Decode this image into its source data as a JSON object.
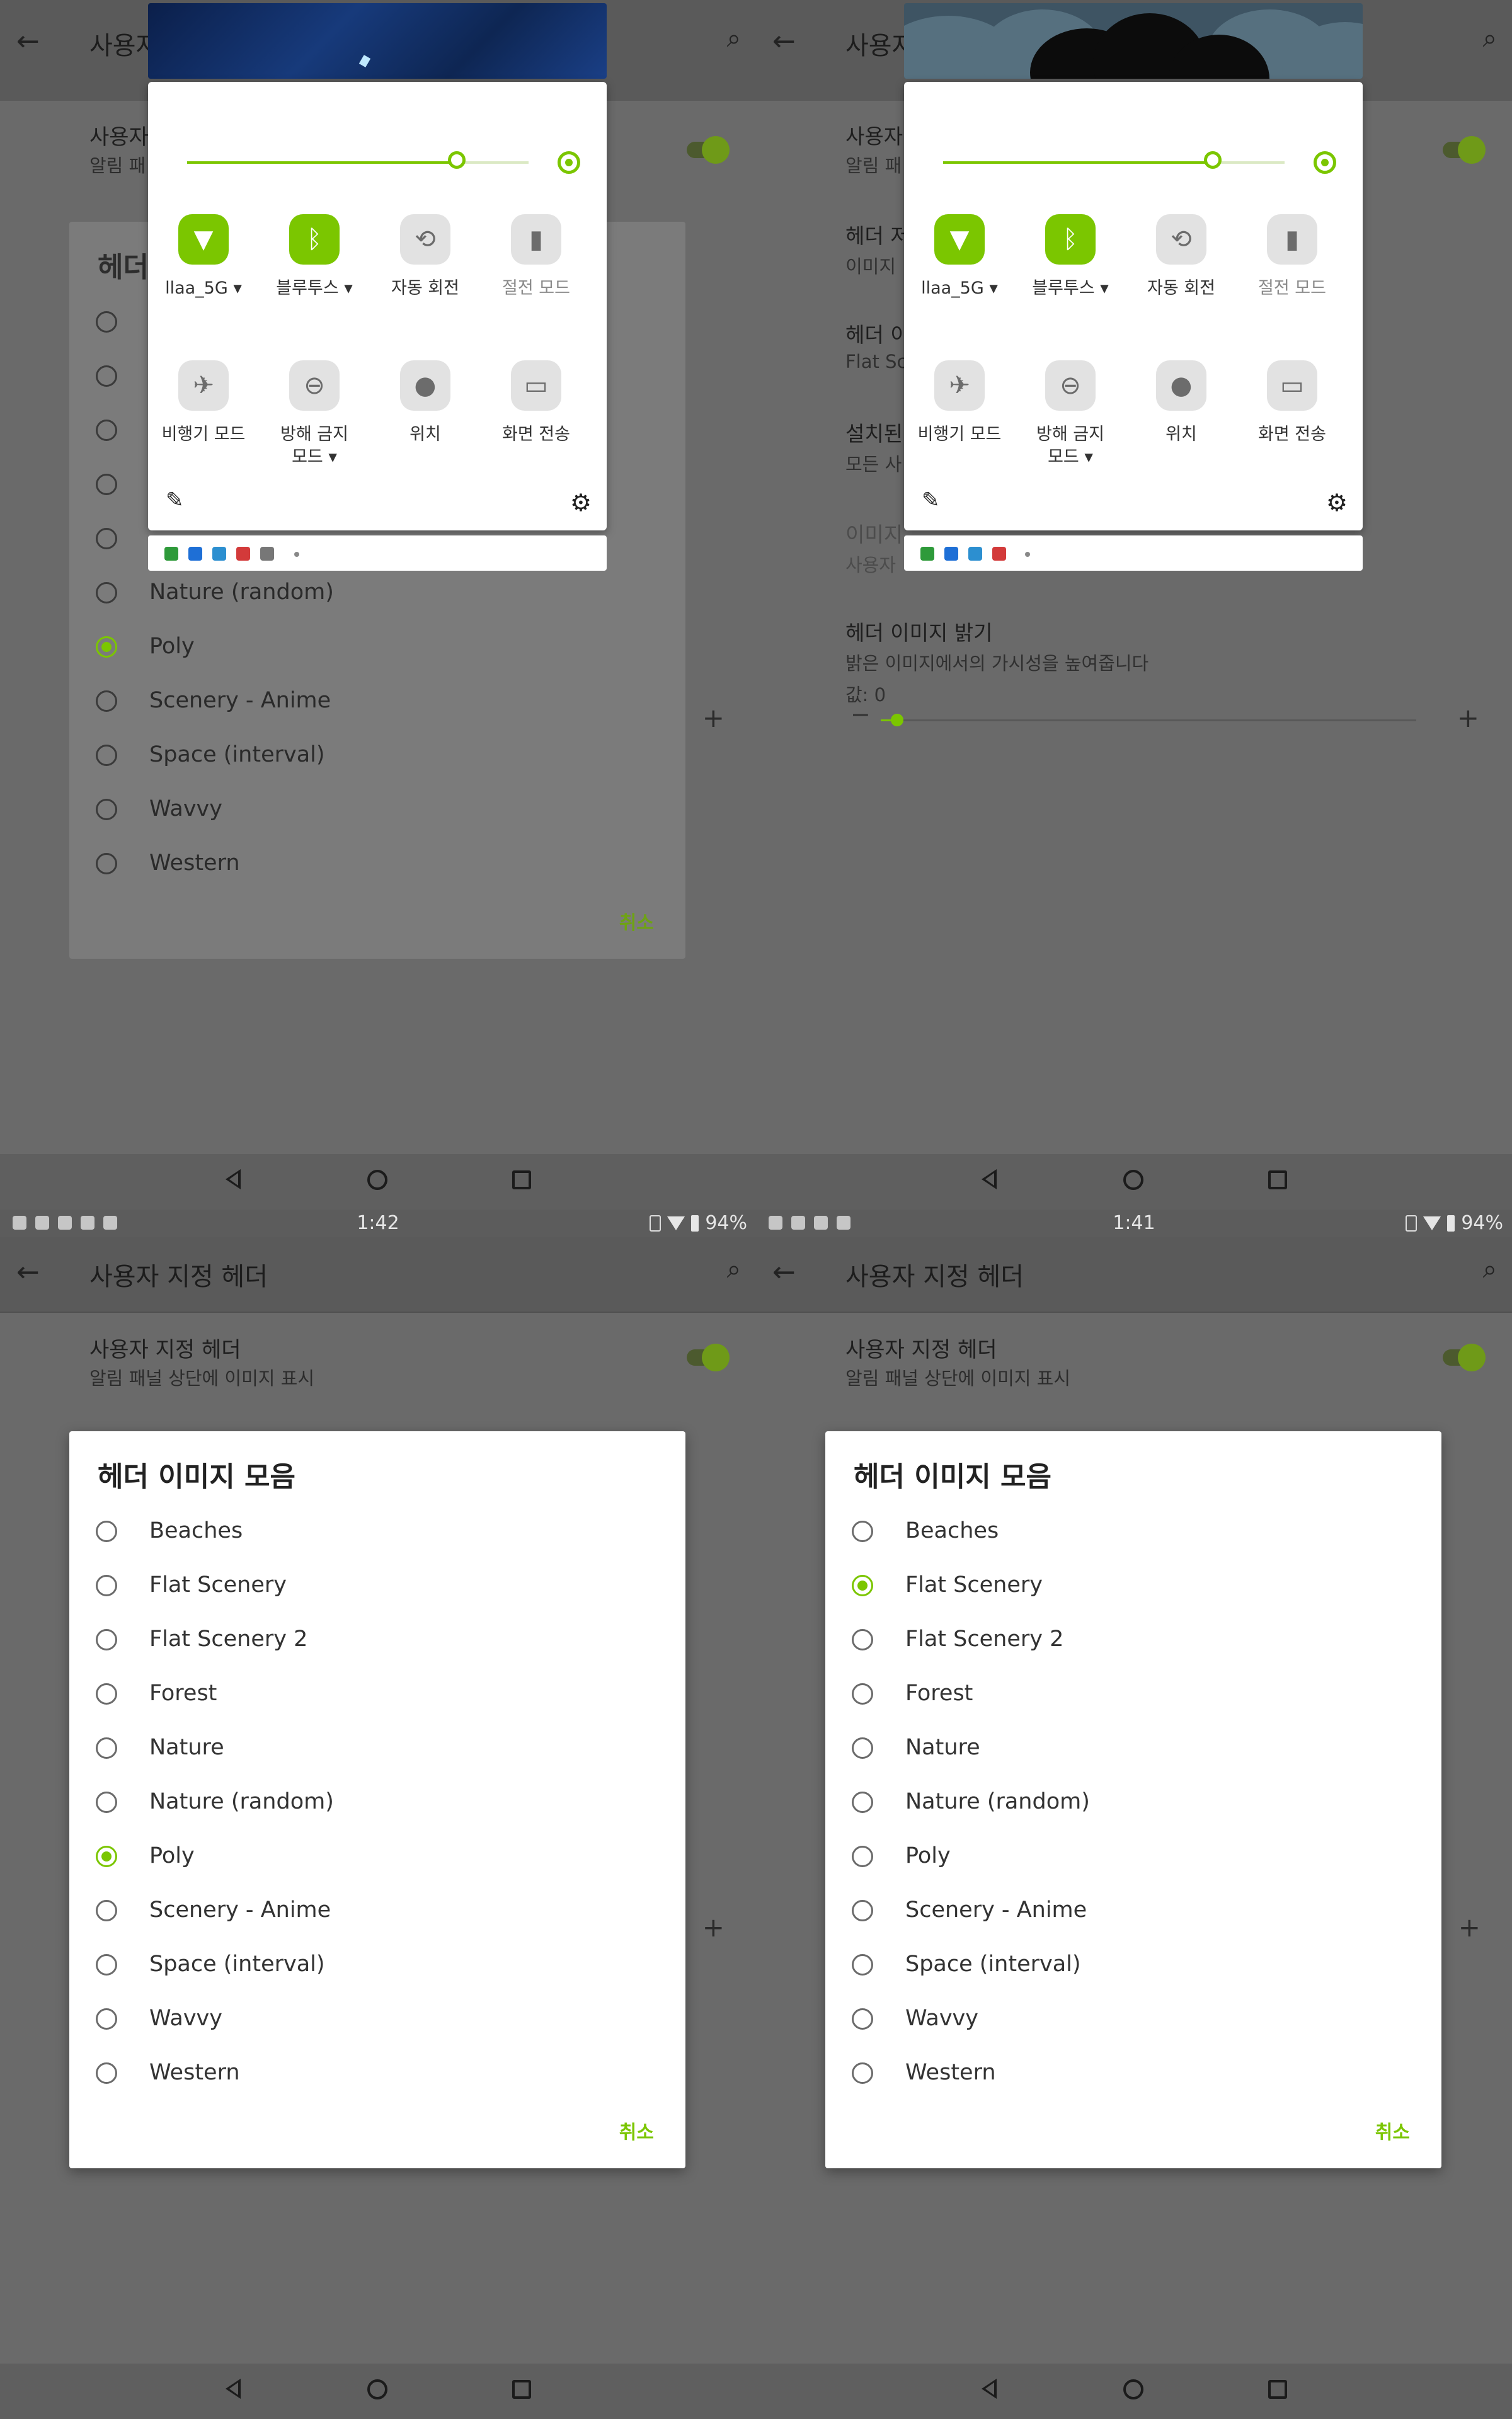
{
  "status": {
    "bottom_left_time": "1:42",
    "bottom_right_time": "1:41",
    "battery": "94%"
  },
  "appbar": {
    "title": "사용자 지정 헤더",
    "title_clipped": "사용자"
  },
  "pref": {
    "custom_header_title": "사용자 지정 헤더",
    "custom_header_sub": "알림 패널 상단에 이미지 표시",
    "custom_header_title_clip": "사용자",
    "custom_header_sub_clip": "알림 패"
  },
  "dialog": {
    "title": "헤더 이미지 모음",
    "title_clip": "헤더",
    "cancel": "취소",
    "options": [
      "Beaches",
      "Flat Scenery",
      "Flat Scenery 2",
      "Forest",
      "Nature",
      "Nature (random)",
      "Poly",
      "Scenery - Anime",
      "Space (interval)",
      "Wavvy",
      "Western"
    ]
  },
  "prefs_right": {
    "header_source_title": "헤더 저",
    "header_source_sub": "이미지",
    "header_image_title": "헤더 이",
    "header_image_sub": "Flat Sc",
    "installed_title": "설치된",
    "installed_sub": "모든 사",
    "image_title_dim": "이미지",
    "image_sub_dim": "사용자",
    "brightness_title": "헤더 이미지 밝기",
    "brightness_sub": "밝은 이미지에서의 가시성을 높여줍니다",
    "brightness_value": "값: 0",
    "brightness_fraction": 0.03
  },
  "quick_settings": {
    "brightness_fraction": 0.79,
    "tiles_row1": [
      {
        "label": "llaa_5G",
        "icon": "wifi-icon",
        "on": true,
        "dropdown": true
      },
      {
        "label": "블루투스",
        "icon": "bluetooth-icon",
        "on": true,
        "dropdown": true
      },
      {
        "label": "자동 회전",
        "icon": "auto-rotate-icon",
        "on": false,
        "dropdown": false
      },
      {
        "label": "절전 모드",
        "icon": "battery-saver-icon",
        "on": false,
        "dropdown": false,
        "disabled": true
      }
    ],
    "tiles_row2": [
      {
        "label": "비행기 모드",
        "icon": "airplane-icon",
        "on": false
      },
      {
        "label": "방해 금지 모드",
        "icon": "do-not-disturb-icon",
        "on": false,
        "dropdown": true
      },
      {
        "label": "위치",
        "icon": "location-icon",
        "on": false
      },
      {
        "label": "화면 전송",
        "icon": "cast-icon",
        "on": false
      }
    ]
  },
  "selection": {
    "top_left": "Poly",
    "bottom_left": "Poly",
    "bottom_right": "Flat Scenery"
  },
  "colors": {
    "accent": "#7bc600",
    "scrim": "#6a6a6a"
  }
}
